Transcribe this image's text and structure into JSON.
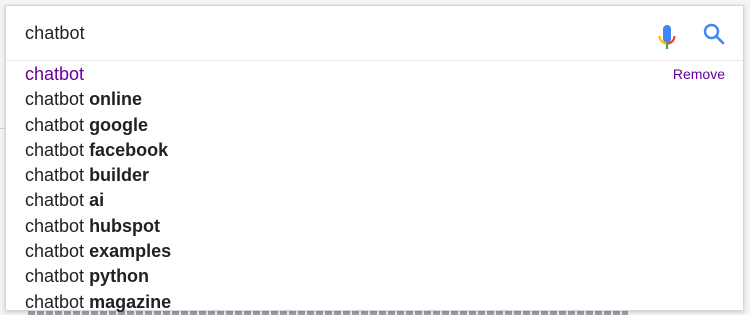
{
  "search": {
    "query": "chatbot"
  },
  "suggestions": [
    {
      "prefix": "chatbot",
      "suffix": "",
      "visited": true,
      "remove_label": "Remove"
    },
    {
      "prefix": "chatbot",
      "suffix": "online"
    },
    {
      "prefix": "chatbot",
      "suffix": "google"
    },
    {
      "prefix": "chatbot",
      "suffix": "facebook"
    },
    {
      "prefix": "chatbot",
      "suffix": "builder"
    },
    {
      "prefix": "chatbot",
      "suffix": "ai"
    },
    {
      "prefix": "chatbot",
      "suffix": "hubspot"
    },
    {
      "prefix": "chatbot",
      "suffix": "examples"
    },
    {
      "prefix": "chatbot",
      "suffix": "python"
    },
    {
      "prefix": "chatbot",
      "suffix": "magazine"
    }
  ],
  "icons": {
    "mic": "microphone-icon",
    "search": "search-icon"
  },
  "colors": {
    "visited_link": "#660099",
    "search_icon_blue": "#4285f4",
    "mic_red": "#ea4335",
    "mic_blue": "#4285f4",
    "mic_green": "#34a853",
    "mic_yellow": "#fbbc05"
  }
}
